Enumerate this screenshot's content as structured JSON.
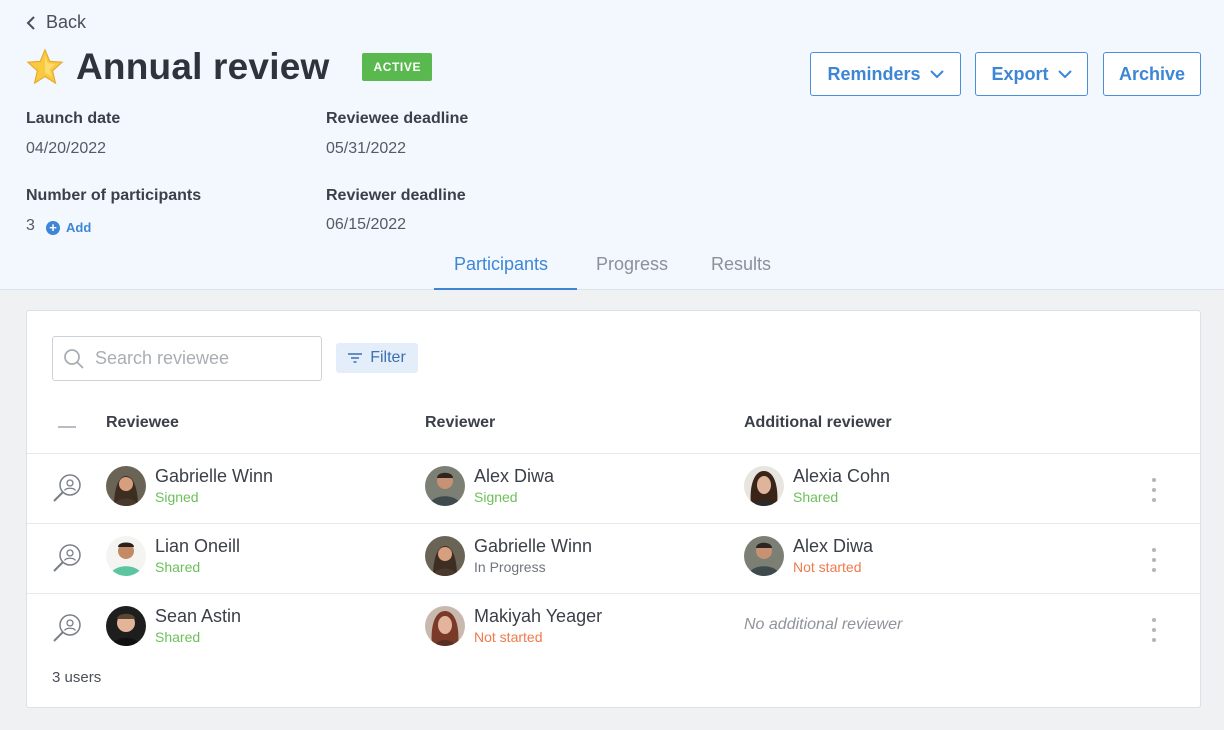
{
  "back_label": "Back",
  "title": "Annual review",
  "status_badge": "ACTIVE",
  "actions": {
    "reminders": "Reminders",
    "export": "Export",
    "archive": "Archive"
  },
  "meta": {
    "launch_date_label": "Launch date",
    "launch_date": "04/20/2022",
    "reviewee_deadline_label": "Reviewee deadline",
    "reviewee_deadline": "05/31/2022",
    "participants_label": "Number of participants",
    "participants_count": "3",
    "add_label": "Add",
    "reviewer_deadline_label": "Reviewer deadline",
    "reviewer_deadline": "06/15/2022"
  },
  "tabs": [
    {
      "label": "Participants",
      "active": true
    },
    {
      "label": "Progress",
      "active": false
    },
    {
      "label": "Results",
      "active": false
    }
  ],
  "search": {
    "placeholder": "Search reviewee",
    "value": ""
  },
  "filter_label": "Filter",
  "columns": {
    "reviewee": "Reviewee",
    "reviewer": "Reviewer",
    "additional": "Additional reviewer"
  },
  "rows": [
    {
      "reviewee": {
        "name": "Gabrielle Winn",
        "status": "Signed"
      },
      "reviewer": {
        "name": "Alex Diwa",
        "status": "Signed"
      },
      "additional": {
        "name": "Alexia Cohn",
        "status": "Shared"
      }
    },
    {
      "reviewee": {
        "name": "Lian Oneill",
        "status": "Shared"
      },
      "reviewer": {
        "name": "Gabrielle Winn",
        "status": "In Progress"
      },
      "additional": {
        "name": "Alex Diwa",
        "status": "Not started"
      }
    },
    {
      "reviewee": {
        "name": "Sean Astin",
        "status": "Shared"
      },
      "reviewer": {
        "name": "Makiyah Yeager",
        "status": "Not started"
      },
      "additional": {
        "empty_text": "No additional reviewer"
      }
    }
  ],
  "user_count": "3 users",
  "colors": {
    "accent": "#3d86d6",
    "badge_green": "#5ab94e",
    "status_green": "#6cc05a",
    "status_orange": "#f07a4a",
    "status_gray": "#70757d"
  }
}
